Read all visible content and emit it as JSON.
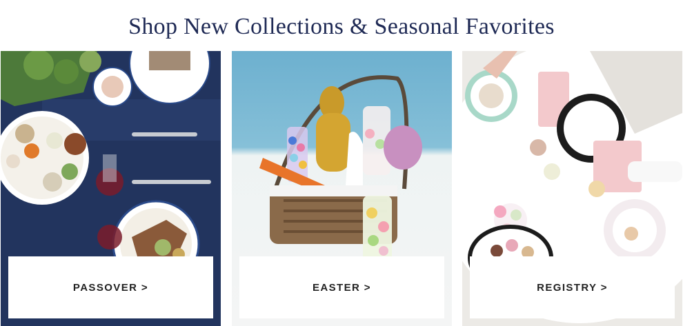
{
  "header": {
    "title": "Shop New Collections & Seasonal Favorites"
  },
  "panels": [
    {
      "id": "passover",
      "cta_label": "PASSOVER >",
      "theme_color": "#22345e"
    },
    {
      "id": "easter",
      "cta_label": "EASTER >",
      "theme_color": "#8fc6dc"
    },
    {
      "id": "registry",
      "cta_label": "REGISTRY >",
      "theme_color": "#eeeeec"
    }
  ]
}
